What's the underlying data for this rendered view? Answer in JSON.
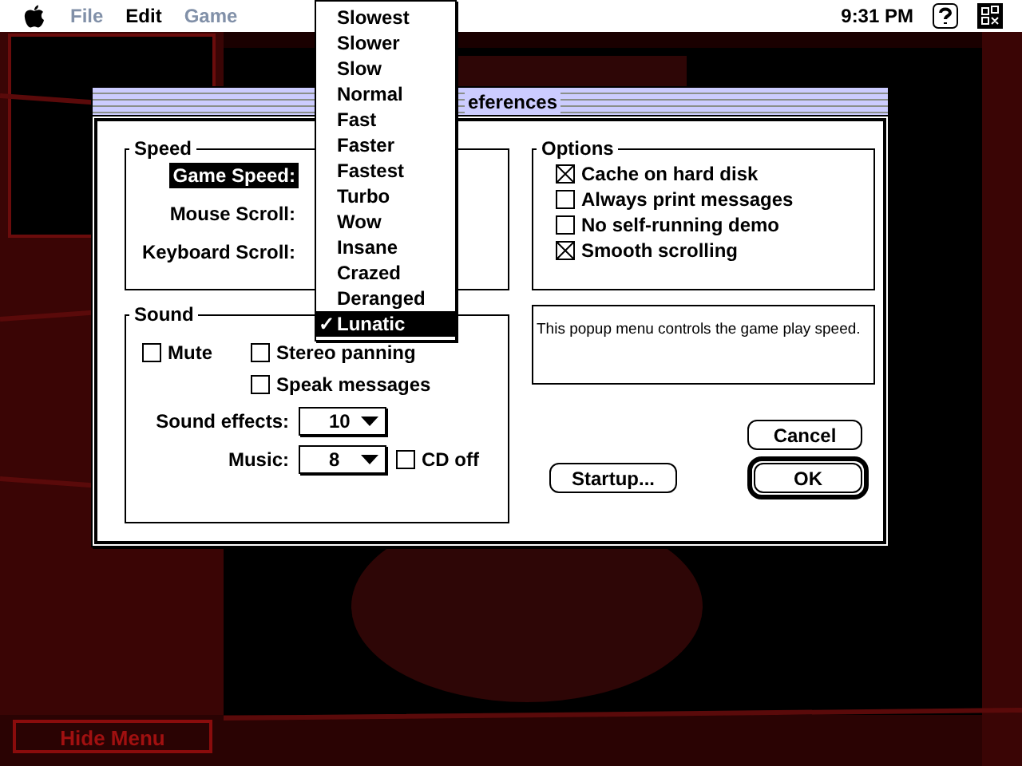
{
  "menu_bar": {
    "menus": [
      {
        "label": "File",
        "disabled": true
      },
      {
        "label": "Edit",
        "disabled": false
      },
      {
        "label": "Game",
        "disabled": true
      }
    ],
    "clock": "9:31 PM"
  },
  "dialog": {
    "title": "eferences",
    "speed": {
      "title": "Speed",
      "labels": [
        {
          "label": "Game Speed:",
          "highlighted": true
        },
        {
          "label": "Mouse Scroll:",
          "highlighted": false
        },
        {
          "label": "Keyboard Scroll:",
          "highlighted": false
        }
      ]
    },
    "sound": {
      "title": "Sound",
      "checkboxes": [
        {
          "label": "Mute",
          "checked": false
        },
        {
          "label": "Stereo panning",
          "checked": false
        },
        {
          "label": "Speak messages",
          "checked": false
        }
      ],
      "sound_effects": {
        "label": "Sound effects:",
        "value": "10"
      },
      "music": {
        "label": "Music:",
        "value": "8"
      },
      "cd_off": {
        "label": "CD off",
        "checked": false
      }
    },
    "options": {
      "title": "Options",
      "items": [
        {
          "label": "Cache on hard disk",
          "checked": true
        },
        {
          "label": "Always print messages",
          "checked": false
        },
        {
          "label": "No self-running demo",
          "checked": false
        },
        {
          "label": "Smooth scrolling",
          "checked": true
        }
      ]
    },
    "help_text": "This popup menu controls the game play speed.",
    "buttons": {
      "cancel": {
        "label": "Cancel",
        "default": false
      },
      "startup": {
        "label": "Startup...",
        "default": false
      },
      "ok": {
        "label": "OK",
        "default": true
      }
    }
  },
  "popup_menu": {
    "check": "✓",
    "items": [
      {
        "label": "Slowest",
        "selected": false
      },
      {
        "label": "Slower",
        "selected": false
      },
      {
        "label": "Slow",
        "selected": false
      },
      {
        "label": "Normal",
        "selected": false
      },
      {
        "label": "Fast",
        "selected": false
      },
      {
        "label": "Faster",
        "selected": false
      },
      {
        "label": "Fastest",
        "selected": false
      },
      {
        "label": "Turbo",
        "selected": false
      },
      {
        "label": "Wow",
        "selected": false
      },
      {
        "label": "Insane",
        "selected": false
      },
      {
        "label": "Crazed",
        "selected": false
      },
      {
        "label": "Deranged",
        "selected": false
      },
      {
        "label": "Lunatic",
        "selected": true
      }
    ]
  },
  "hide_menu_button": "Hide Menu"
}
